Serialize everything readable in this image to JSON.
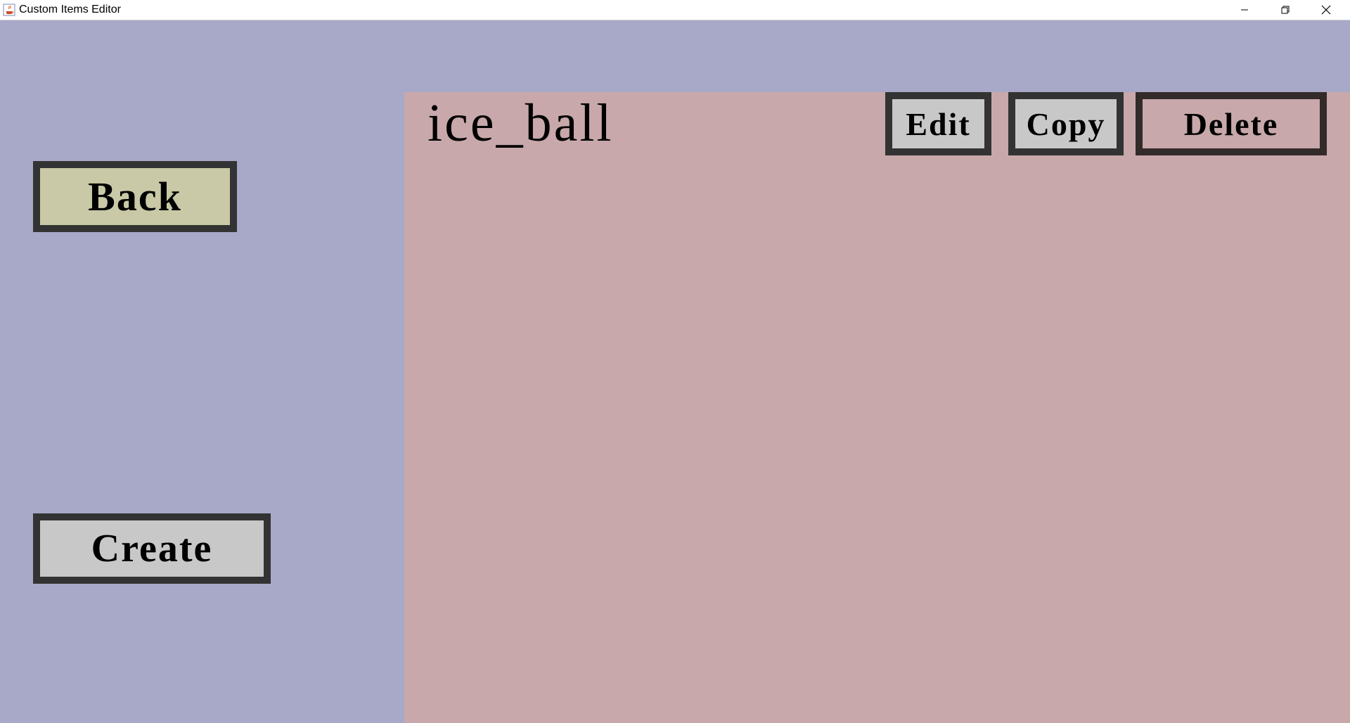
{
  "window": {
    "title": "Custom Items Editor",
    "controls": {
      "minimize_icon": "minimize-icon",
      "maximize_icon": "restore-icon",
      "close_icon": "close-icon"
    }
  },
  "sidebar": {
    "back_label": "Back",
    "create_label": "Create"
  },
  "item": {
    "name": "ice_ball",
    "edit_label": "Edit",
    "copy_label": "Copy",
    "delete_label": "Delete"
  },
  "colors": {
    "background": "#a8a8c8",
    "main_panel": "#c8a8aa",
    "back_button": "#c9c9a7",
    "neutral_button": "#c8c8c8",
    "delete_button": "#c8a8aa",
    "button_border": "#333333"
  }
}
